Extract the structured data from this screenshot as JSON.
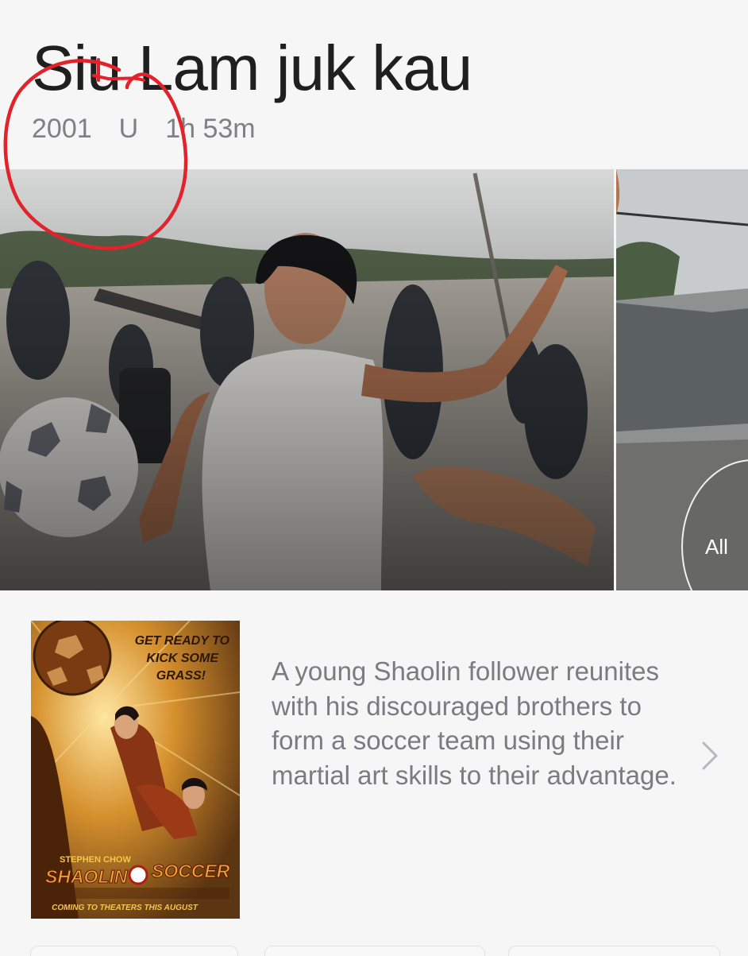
{
  "movie": {
    "title": "Siu Lam juk kau",
    "year": "2001",
    "rating": "U",
    "runtime": "1h 53m",
    "description": "A young Shaolin follower reunites with his discouraged brothers to form a soccer team using their martial art skills to their advantage."
  },
  "gallery": {
    "all_label": "All"
  },
  "poster": {
    "tagline": [
      "GET READY TO",
      "KICK SOME",
      "GRASS!"
    ],
    "credit": "STEPHEN CHOW",
    "title_left": "SHAOLIN",
    "title_right": "SOCCER",
    "release": "COMING TO THEATERS THIS AUGUST"
  },
  "icons": {
    "detail": "chevron-right-icon",
    "annotation": "red-circle-annotation"
  },
  "colors": {
    "title": "#1f1f1f",
    "meta": "#7f7f84",
    "annotation": "#e2232b",
    "background": "#f6f6f7"
  }
}
